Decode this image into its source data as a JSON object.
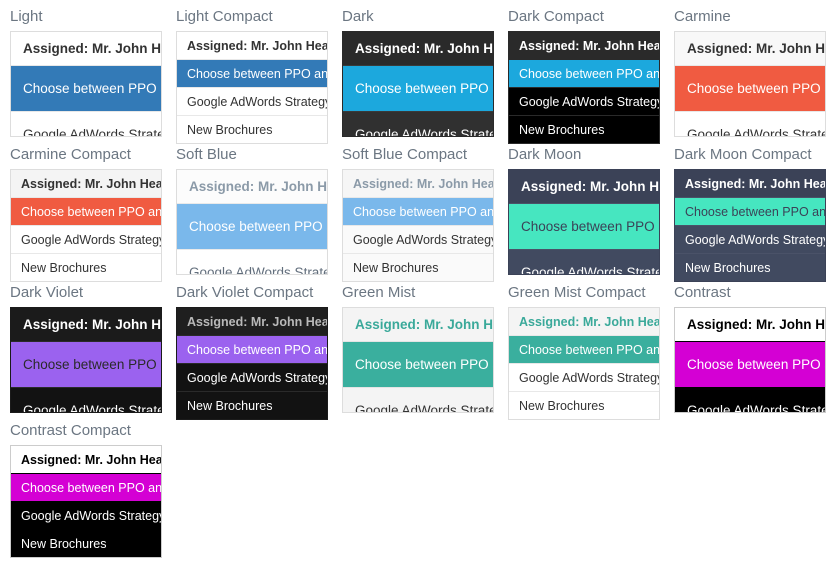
{
  "page": {
    "background": "#ffffff",
    "title_color": "#6b7682"
  },
  "list_content": {
    "header": "Assigned: Mr. John Heart",
    "items": [
      "Choose between PPO and HMO Health Plan",
      "Google AdWords Strategy",
      "New Brochures"
    ],
    "selected_index": 0
  },
  "themes": [
    {
      "name": "Light",
      "size": "normal",
      "colors": {
        "border": "#dddddd",
        "header_bg": "#ffffff",
        "header_text": "#333333",
        "item_bg": "#ffffff",
        "item_text": "#333333",
        "separator": "#e8e8e8",
        "selected_bg": "#337ab7",
        "selected_text": "#ffffff"
      }
    },
    {
      "name": "Light Compact",
      "size": "compact",
      "colors": {
        "border": "#dddddd",
        "header_bg": "#ffffff",
        "header_text": "#333333",
        "item_bg": "#ffffff",
        "item_text": "#333333",
        "separator": "#e8e8e8",
        "selected_bg": "#337ab7",
        "selected_text": "#ffffff"
      }
    },
    {
      "name": "Dark",
      "size": "normal",
      "colors": {
        "border": "#2a2a2a",
        "header_bg": "#2a2a2a",
        "header_text": "#ffffff",
        "item_bg": "#303030",
        "item_text": "#ffffff",
        "separator": "#3a3a3a",
        "selected_bg": "#1ca8dd",
        "selected_text": "#ffffff"
      }
    },
    {
      "name": "Dark Compact",
      "size": "compact",
      "colors": {
        "border": "#2a2a2a",
        "header_bg": "#2a2a2a",
        "header_text": "#ffffff",
        "item_bg": "#000000",
        "item_text": "#ffffff",
        "separator": "#2a2a2a",
        "selected_bg": "#1ca8dd",
        "selected_text": "#ffffff"
      }
    },
    {
      "name": "Carmine",
      "size": "normal",
      "colors": {
        "border": "#dddddd",
        "header_bg": "#f8f8f8",
        "header_text": "#333333",
        "item_bg": "#ffffff",
        "item_text": "#333333",
        "separator": "#e8e8e8",
        "selected_bg": "#f05b41",
        "selected_text": "#ffffff"
      }
    },
    {
      "name": "Carmine Compact",
      "size": "compact",
      "colors": {
        "border": "#dddddd",
        "header_bg": "#f4f4f4",
        "header_text": "#333333",
        "item_bg": "#ffffff",
        "item_text": "#333333",
        "separator": "#e8e8e8",
        "selected_bg": "#f05b41",
        "selected_text": "#ffffff"
      }
    },
    {
      "name": "Soft Blue",
      "size": "normal",
      "colors": {
        "border": "#dddddd",
        "header_bg": "#fcfcfc",
        "header_text": "#8b9aa8",
        "item_bg": "#ffffff",
        "item_text": "#626e7c",
        "separator": "#eaeaea",
        "selected_bg": "#7ab8eb",
        "selected_text": "#ffffff"
      }
    },
    {
      "name": "Soft Blue Compact",
      "size": "compact",
      "colors": {
        "border": "#dddddd",
        "header_bg": "#f6f6f6",
        "header_text": "#8b9aa8",
        "item_bg": "#fafafa",
        "item_text": "#333333",
        "separator": "#e8e8e8",
        "selected_bg": "#7ab8eb",
        "selected_text": "#ffffff"
      }
    },
    {
      "name": "Dark Moon",
      "size": "normal",
      "colors": {
        "border": "#3b4257",
        "header_bg": "#3b4257",
        "header_text": "#ffffff",
        "item_bg": "#414a60",
        "item_text": "#ffffff",
        "separator": "#4a5268",
        "selected_bg": "#46e6c0",
        "selected_text": "#3b4257"
      }
    },
    {
      "name": "Dark Moon Compact",
      "size": "compact",
      "colors": {
        "border": "#3b4257",
        "header_bg": "#3b4257",
        "header_text": "#ffffff",
        "item_bg": "#414a60",
        "item_text": "#ffffff",
        "separator": "#4a5268",
        "selected_bg": "#46e6c0",
        "selected_text": "#3b4257"
      }
    },
    {
      "name": "Dark Violet",
      "size": "normal",
      "colors": {
        "border": "#1b1b1b",
        "header_bg": "#1b1b1b",
        "header_text": "#ffffff",
        "item_bg": "#121212",
        "item_text": "#ffffff",
        "separator": "#2a2a2a",
        "selected_bg": "#9b62ef",
        "selected_text": "#2a2a2a"
      }
    },
    {
      "name": "Dark Violet Compact",
      "size": "compact",
      "colors": {
        "border": "#1b1b1b",
        "header_bg": "#1f1f1f",
        "header_text": "#b9b9b9",
        "item_bg": "#121212",
        "item_text": "#ffffff",
        "separator": "#2a2a2a",
        "selected_bg": "#9b62ef",
        "selected_text": "#ffffff"
      }
    },
    {
      "name": "Green Mist",
      "size": "normal",
      "colors": {
        "border": "#dddddd",
        "header_bg": "#f4f4f4",
        "header_text": "#3aa99a",
        "item_bg": "#f4f4f4",
        "item_text": "#333333",
        "separator": "#e4e4e4",
        "selected_bg": "#3aaf9e",
        "selected_text": "#ffffff"
      }
    },
    {
      "name": "Green Mist Compact",
      "size": "compact",
      "colors": {
        "border": "#dddddd",
        "header_bg": "#f4f4f4",
        "header_text": "#3aa99a",
        "item_bg": "#ffffff",
        "item_text": "#333333",
        "separator": "#e8e8e8",
        "selected_bg": "#3aaf9e",
        "selected_text": "#ffffff"
      }
    },
    {
      "name": "Contrast",
      "size": "normal",
      "colors": {
        "border": "#cccccc",
        "header_bg": "#ffffff",
        "header_text": "#000000",
        "item_bg": "#000000",
        "item_text": "#ffffff",
        "separator": "#000000",
        "selected_bg": "#d400d4",
        "selected_text": "#ffffff"
      }
    },
    {
      "name": "Contrast Compact",
      "size": "compact",
      "colors": {
        "border": "#cccccc",
        "header_bg": "#ffffff",
        "header_text": "#000000",
        "item_bg": "#000000",
        "item_text": "#ffffff",
        "separator": "#000000",
        "selected_bg": "#d400d4",
        "selected_text": "#ffffff"
      }
    }
  ]
}
